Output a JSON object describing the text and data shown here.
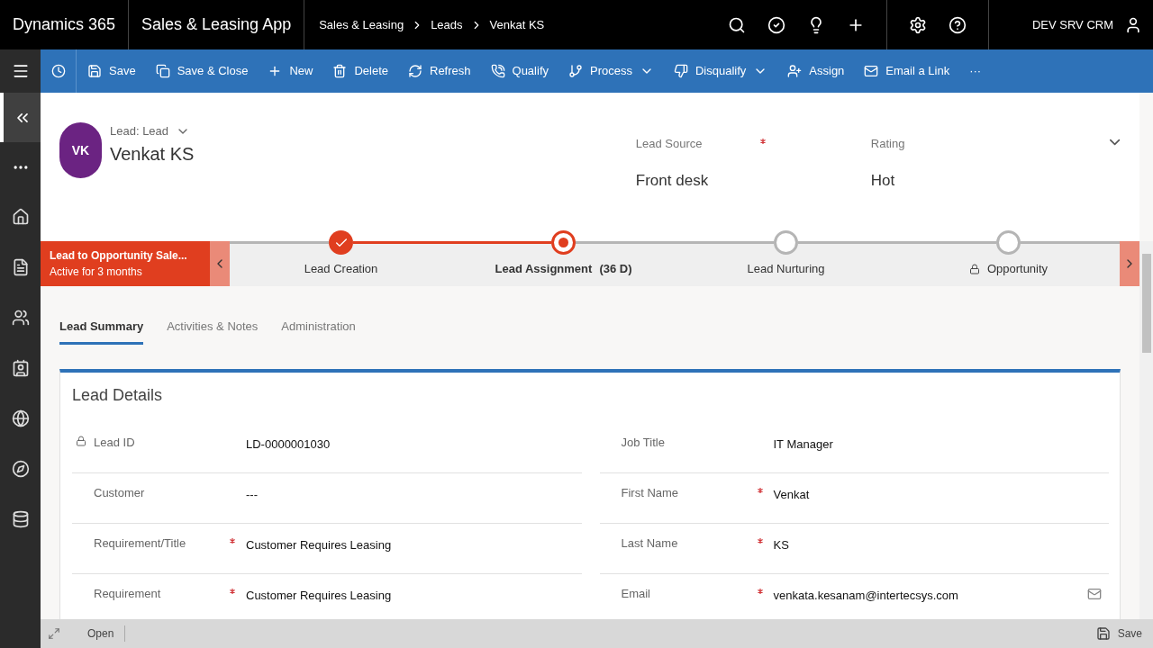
{
  "top_bar": {
    "product": "Dynamics 365",
    "app": "Sales & Leasing App",
    "breadcrumbs": [
      "Sales & Leasing",
      "Leads",
      "Venkat KS"
    ],
    "user": "DEV SRV CRM"
  },
  "command_bar": [
    {
      "kind": "save",
      "label": "Save",
      "dropdown": false
    },
    {
      "kind": "save-close",
      "label": "Save & Close",
      "dropdown": false
    },
    {
      "kind": "new",
      "label": "New",
      "dropdown": false
    },
    {
      "kind": "delete",
      "label": "Delete",
      "dropdown": false
    },
    {
      "kind": "refresh",
      "label": "Refresh",
      "dropdown": false
    },
    {
      "kind": "qualify",
      "label": "Qualify",
      "dropdown": false
    },
    {
      "kind": "process",
      "label": "Process",
      "dropdown": true
    },
    {
      "kind": "disqualify",
      "label": "Disqualify",
      "dropdown": true
    },
    {
      "kind": "assign",
      "label": "Assign",
      "dropdown": false
    },
    {
      "kind": "email",
      "label": "Email a Link",
      "dropdown": false
    },
    {
      "kind": "more",
      "label": "···",
      "dropdown": false
    }
  ],
  "header": {
    "initials": "VK",
    "entity": "Lead: Lead",
    "name": "Venkat KS",
    "fields": [
      {
        "label": "Lead Source",
        "required": true,
        "value": "Front desk"
      },
      {
        "label": "Rating",
        "required": false,
        "value": "Hot"
      }
    ]
  },
  "process": {
    "name": "Lead to Opportunity Sale...",
    "status": "Active for 3 months",
    "stages": [
      {
        "name": "Lead Creation",
        "completed": true,
        "selected": false,
        "locked": false
      },
      {
        "name": "Lead Assignment",
        "duration": "(36 D)",
        "completed": false,
        "selected": true,
        "locked": false
      },
      {
        "name": "Lead Nurturing",
        "completed": false,
        "selected": false,
        "locked": false
      },
      {
        "name": "Opportunity",
        "completed": false,
        "selected": false,
        "locked": true
      }
    ]
  },
  "tabs": [
    {
      "label": "Lead Summary",
      "selected": true
    },
    {
      "label": "Activities & Notes",
      "selected": false
    },
    {
      "label": "Administration",
      "selected": false
    }
  ],
  "section": {
    "title": "Lead Details",
    "left_fields": [
      {
        "label": "Lead ID",
        "locked": true,
        "required": false,
        "value": "LD-0000001030",
        "email_action": false
      },
      {
        "label": "Customer",
        "locked": false,
        "required": false,
        "value": "---",
        "email_action": false
      },
      {
        "label": "Requirement/Title",
        "locked": false,
        "required": true,
        "value": "Customer Requires Leasing",
        "email_action": false
      },
      {
        "label": "Requirement",
        "locked": false,
        "required": true,
        "value": "Customer Requires Leasing",
        "email_action": false
      }
    ],
    "right_fields": [
      {
        "label": "Job Title",
        "locked": false,
        "required": false,
        "value": "IT Manager",
        "email_action": false
      },
      {
        "label": "First Name",
        "locked": false,
        "required": true,
        "value": "Venkat",
        "email_action": false
      },
      {
        "label": "Last Name",
        "locked": false,
        "required": true,
        "value": "KS",
        "email_action": false
      },
      {
        "label": "Email",
        "locked": false,
        "required": true,
        "value": "venkata.kesanam@intertecsys.com",
        "email_action": true
      }
    ]
  },
  "status_bar": {
    "open": "Open",
    "save": "Save"
  }
}
